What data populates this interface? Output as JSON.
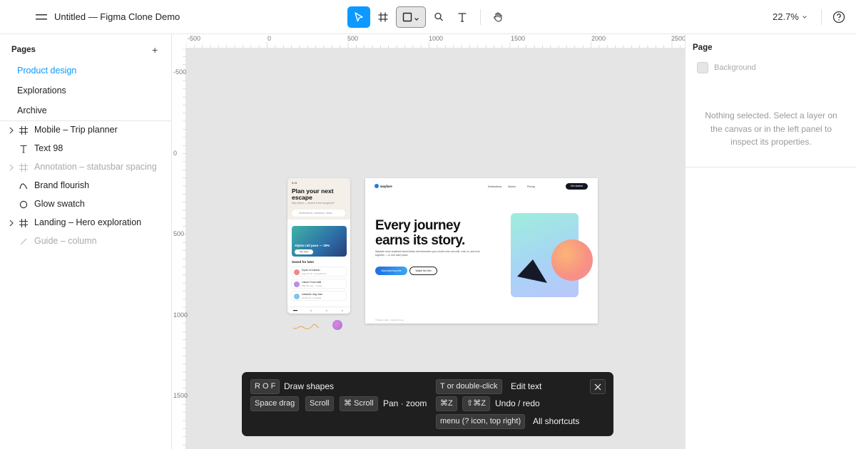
{
  "app": {
    "document_title": "Untitled — Figma Clone Demo",
    "zoom": "22.7%",
    "accent_color": "#0d99ff"
  },
  "toolbar": {
    "tools": [
      "move-tool",
      "frame-tool",
      "shape-tool",
      "pen-tool",
      "text-tool",
      "hand-tool"
    ],
    "active_tool": "move-tool"
  },
  "pages": {
    "heading": "Pages",
    "add_label": "+",
    "items": [
      {
        "label": "Product design",
        "active": true
      },
      {
        "label": "Explorations",
        "active": false
      },
      {
        "label": "Archive",
        "active": false
      }
    ]
  },
  "layers": [
    {
      "name": "Mobile – Trip planner",
      "icon": "frame-icon",
      "expandable": true,
      "hidden": false
    },
    {
      "name": "Text 98",
      "icon": "text-icon",
      "expandable": false,
      "hidden": false
    },
    {
      "name": "Annotation – statusbar spacing",
      "icon": "frame-icon",
      "expandable": true,
      "hidden": true
    },
    {
      "name": "Brand flourish",
      "icon": "path-icon",
      "expandable": false,
      "hidden": false
    },
    {
      "name": "Glow swatch",
      "icon": "ellipse-icon",
      "expandable": false,
      "hidden": false
    },
    {
      "name": "Landing – Hero exploration",
      "icon": "frame-icon",
      "expandable": true,
      "hidden": false
    },
    {
      "name": "Guide – column",
      "icon": "line-icon",
      "expandable": false,
      "hidden": true
    }
  ],
  "rulers": {
    "top": [
      "-500",
      "0",
      "500",
      "1000",
      "1500",
      "2000",
      "2500"
    ],
    "left": [
      "-500",
      "0",
      "500",
      "1000",
      "1500"
    ]
  },
  "mobile_frame": {
    "status": "9:41",
    "title": "Plan your next escape",
    "subtitle": "Stay Wave — search in the doughnut?",
    "search_placeholder": "Destinations, vacations, ideas…",
    "card_text": "Alpine rail pass — 30%",
    "card_button": "See pass",
    "saved_heading": "Saved for later",
    "rows": [
      {
        "title": "Kyoto in Autumn",
        "sub": "Aug 12–18 · 6 people left",
        "color": "#f08a8a"
      },
      {
        "title": "Lisbon Food walk",
        "sub": "May 30–Jun · 4 spots",
        "color": "#b78ee8"
      },
      {
        "title": "Icelandic ring road",
        "sub": "Jul 03–14 · 6 people",
        "color": "#7fc6ec"
      }
    ]
  },
  "desktop_frame": {
    "logo": "wayfare",
    "nav": [
      "Destinations",
      "Stories",
      "Pricing"
    ],
    "cta": "Get started",
    "headline_line1": "Every journey",
    "headline_line2": "earns its story.",
    "body": "Wayfare turns scattered travel ideas into itineraries your whole crew can edit, vote on, and love together — in one calm place.",
    "primary_button": "Start planning free",
    "secondary_button": "Watch the film",
    "footer": "© Wayfare studio · crafted with care"
  },
  "shortcuts": {
    "draw_keys": "R O F",
    "draw_label": "Draw shapes",
    "pan_keys": [
      "Space drag",
      "Scroll",
      "⌘ Scroll"
    ],
    "pan_label": "Pan · zoom",
    "edit_keys": "T or double-click",
    "edit_label": "Edit text",
    "undo_keys": [
      "⌘Z",
      "⇧⌘Z"
    ],
    "undo_label": "Undo / redo",
    "all_keys": "menu (? icon, top right)",
    "all_label": "All shortcuts"
  },
  "inspector": {
    "heading": "Page",
    "background_label": "Background",
    "background_color": "#e5e5e5",
    "empty_message": "Nothing selected. Select a layer on the canvas or in the left panel to inspect its properties."
  }
}
